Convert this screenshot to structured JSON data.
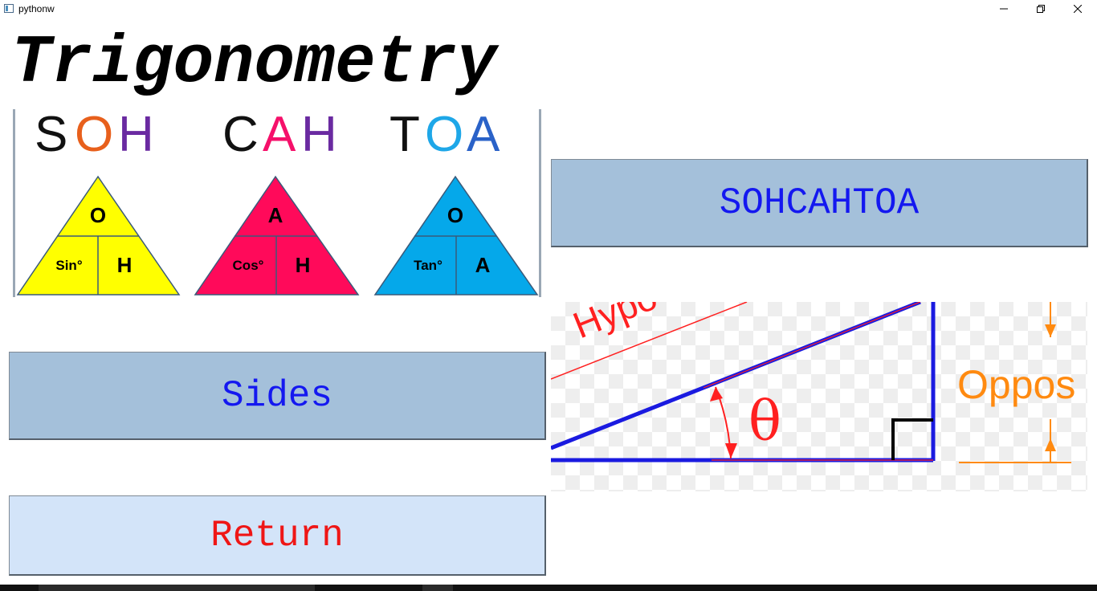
{
  "window": {
    "title": "pythonw",
    "controls": [
      "minimize",
      "restore",
      "close"
    ]
  },
  "heading": "Trigonometry",
  "triangles": [
    {
      "mnemonic_letters": [
        "S",
        "O",
        "H"
      ],
      "mnemonic_colors": [
        "#111111",
        "#e8601c",
        "#6a2aa1"
      ],
      "fill": "#ffff00",
      "top": "O",
      "bottom_left": "Sin°",
      "bottom_right": "H"
    },
    {
      "mnemonic_letters": [
        "C",
        "A",
        "H"
      ],
      "mnemonic_colors": [
        "#111111",
        "#f5106a",
        "#6a2aa1"
      ],
      "fill": "#ff0a5a",
      "top": "A",
      "bottom_left": "Cos°",
      "bottom_right": "H"
    },
    {
      "mnemonic_letters": [
        "T",
        "O",
        "A"
      ],
      "mnemonic_colors": [
        "#111111",
        "#1ea7e8",
        "#2a62c8"
      ],
      "fill": "#05a8ea",
      "top": "O",
      "bottom_left": "Tan°",
      "bottom_right": "A"
    }
  ],
  "buttons": {
    "sohcahtoa": "SOHCAHTOA",
    "sides": "Sides",
    "return": "Return"
  },
  "diagram": {
    "hypotenuse_label": "Hypo",
    "angle_label": "θ",
    "opposite_label": "Oppos"
  },
  "colors": {
    "button_fill": "#a4c0da",
    "return_fill": "#d3e4f9",
    "button_text": "#1418f0",
    "return_text": "#ef1616"
  }
}
